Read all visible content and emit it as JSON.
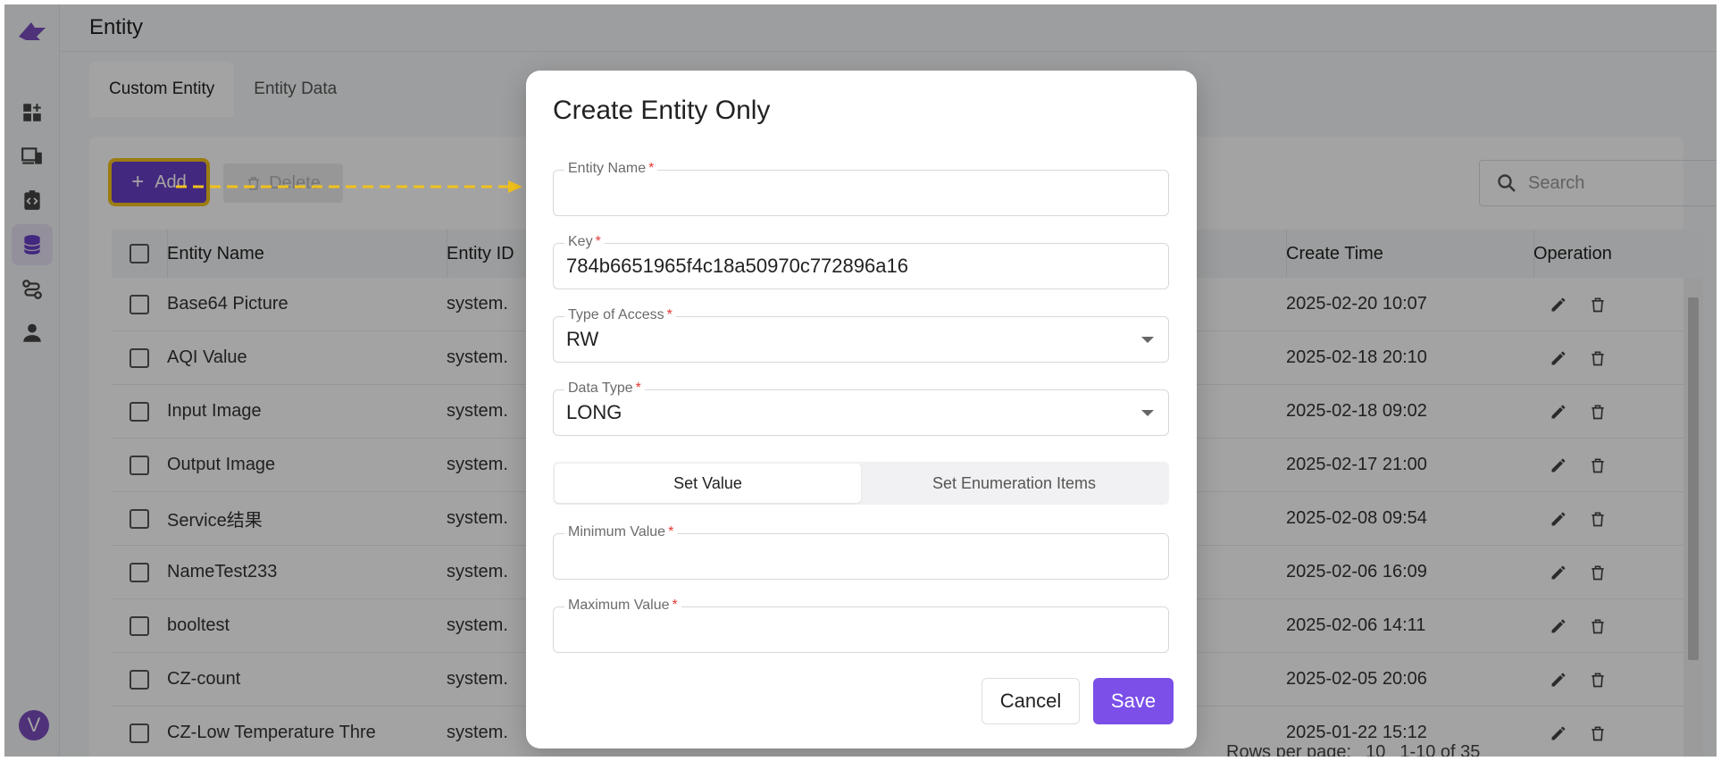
{
  "page": {
    "title": "Entity"
  },
  "tabs": [
    {
      "label": "Custom Entity"
    },
    {
      "label": "Entity Data"
    }
  ],
  "toolbar": {
    "add_label": "Add",
    "delete_label": "Delete",
    "search_placeholder": "Search"
  },
  "table": {
    "headers": {
      "name": "Entity Name",
      "id": "Entity ID",
      "time": "Create Time",
      "op": "Operation"
    },
    "rows": [
      {
        "name": "Base64 Picture",
        "id": "system.",
        "time": "2025-02-20 10:07"
      },
      {
        "name": "AQI Value",
        "id": "system.",
        "time": "2025-02-18 20:10"
      },
      {
        "name": "Input Image",
        "id": "system.",
        "time": "2025-02-18 09:02"
      },
      {
        "name": "Output Image",
        "id": "system.",
        "time": "2025-02-17 21:00"
      },
      {
        "name": "Service结果",
        "id": "system.",
        "time": "2025-02-08 09:54"
      },
      {
        "name": "NameTest233",
        "id": "system.",
        "time": "2025-02-06 16:09"
      },
      {
        "name": "booltest",
        "id": "system.",
        "time": "2025-02-06 14:11"
      },
      {
        "name": "CZ-count",
        "id": "system.",
        "time": "2025-02-05 20:06"
      },
      {
        "name": "CZ-Low Temperature Thre",
        "id": "system.",
        "time": "2025-01-22 15:12"
      }
    ]
  },
  "footer": {
    "rows_per_page_label": "Rows per page:",
    "rows_per_page": "10",
    "range": "1-10 of 35"
  },
  "sidebar": {
    "avatar_letter": "V"
  },
  "modal": {
    "title": "Create Entity Only",
    "fields": {
      "entity_name": {
        "label": "Entity Name",
        "value": ""
      },
      "key": {
        "label": "Key",
        "value": "784b6651965f4c18a50970c772896a16"
      },
      "access_type": {
        "label": "Type of Access",
        "value": "RW"
      },
      "data_type": {
        "label": "Data Type",
        "value": "LONG"
      },
      "min_value": {
        "label": "Minimum Value",
        "value": ""
      },
      "max_value": {
        "label": "Maximum Value",
        "value": ""
      }
    },
    "segments": {
      "set_value": "Set Value",
      "set_enum": "Set Enumeration Items"
    },
    "buttons": {
      "cancel": "Cancel",
      "save": "Save"
    }
  },
  "colors": {
    "primary": "#6a3fc7",
    "save": "#7b4fe8",
    "highlight": "#f2c21c",
    "required": "#e53935"
  }
}
